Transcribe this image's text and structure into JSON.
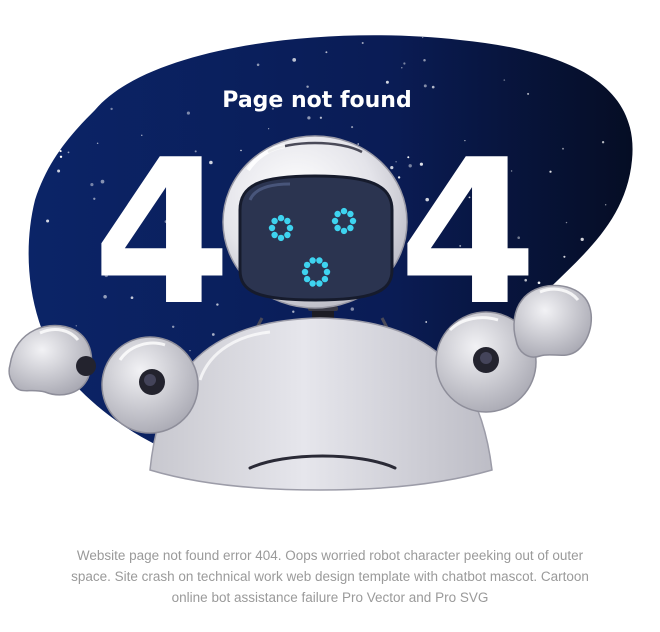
{
  "illustration": {
    "heading": "Page not found",
    "error_left_digit": "4",
    "error_right_digit": "4",
    "colors": {
      "space_dark": "#0a1f5c",
      "space_edge": "#06112e",
      "robot_body": "#d9d9de",
      "robot_shadow": "#b7b7bf",
      "visor": "#2a3550",
      "eye_glow": "#3ed3ef",
      "digit_fill": "#ffffff"
    }
  },
  "caption": {
    "text": "Website page not found error 404. Oops worried robot character peeking out of outer space. Site crash on technical work web design template with chatbot mascot. Cartoon online bot assistance failure Pro Vector and Pro SVG"
  }
}
